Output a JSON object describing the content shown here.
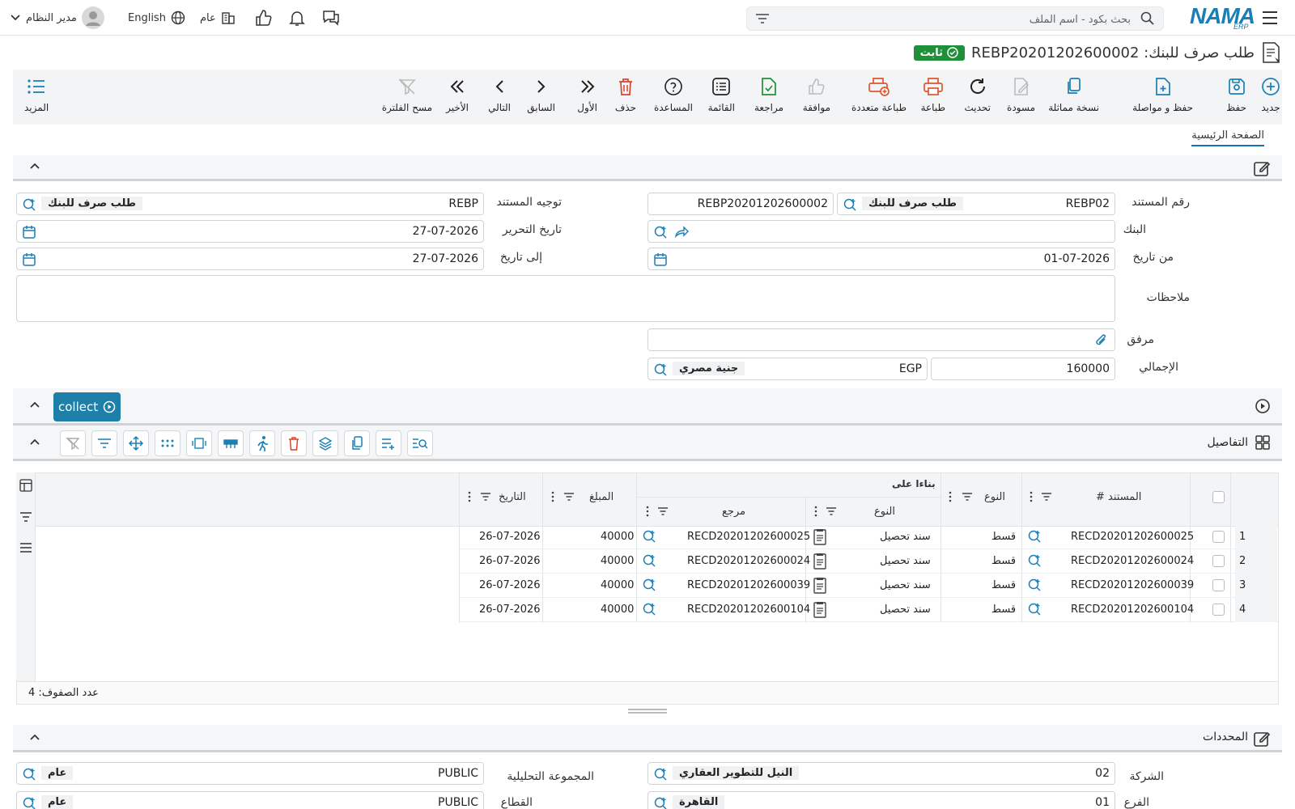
{
  "topbar": {
    "search_placeholder": "بحث بكود - اسم الملف",
    "user": "مدير النظام",
    "language": "English",
    "scope": "عام",
    "logo": "NAMA",
    "logo_sub": "ERP"
  },
  "title": {
    "text": "طلب صرف للبنك: REBP20201202600002",
    "status": "ثابت"
  },
  "toolbar": {
    "new": "جديد",
    "save": "حفظ",
    "save_continue": "حفظ و مواصلة",
    "duplicate": "نسخة مماثلة",
    "draft": "مسودة",
    "refresh": "تحديث",
    "print": "طباعة",
    "multi_print": "طباعة متعددة",
    "approve": "موافقة",
    "review": "مراجعة",
    "list": "القائمة",
    "help": "المساعدة",
    "delete": "حذف",
    "first": "الأول",
    "previous": "السابق",
    "next": "التالي",
    "last": "الأخير",
    "clear_filter": "مسح الفلترة",
    "more": "المزيد"
  },
  "tabs": {
    "main": "الصفحة الرئيسية"
  },
  "form": {
    "doc_number_label": "رقم المستند",
    "doc_book_code": "REBP02",
    "doc_book_name": "طلب صرف للبنك",
    "doc_code": "REBP20201202600002",
    "doc_direction_label": "توجيه المستند",
    "doc_direction_code": "REBP",
    "doc_direction_name": "طلب صرف للبنك",
    "bank_label": "البنك",
    "issue_date_label": "تاريخ التحرير",
    "issue_date": "27-07-2026",
    "from_date_label": "من تاريخ",
    "from_date": "01-07-2026",
    "to_date_label": "إلى تاريخ",
    "to_date": "27-07-2026",
    "notes_label": "ملاحظات",
    "attachment_label": "مرفق",
    "total_label": "الإجمالي",
    "total_value": "160000",
    "currency_code": "EGP",
    "currency_name": "جنية مصري"
  },
  "collect": {
    "label": "collect"
  },
  "details": {
    "title": "التفاصيل",
    "columns": {
      "doc": "# المستند",
      "type": "النوع",
      "based_on": "بناءا على",
      "based_type": "النوع",
      "ref": "مرجع",
      "amount": "المبلغ",
      "date": "التاريخ"
    },
    "rows": [
      {
        "n": "1",
        "doc": "RECD20201202600025",
        "type": "قسط",
        "based_type": "سند تحصيل",
        "ref": "RECD20201202600025",
        "amount": "40000",
        "date": "26-07-2026"
      },
      {
        "n": "2",
        "doc": "RECD20201202600024",
        "type": "قسط",
        "based_type": "سند تحصيل",
        "ref": "RECD20201202600024",
        "amount": "40000",
        "date": "26-07-2026"
      },
      {
        "n": "3",
        "doc": "RECD20201202600039",
        "type": "قسط",
        "based_type": "سند تحصيل",
        "ref": "RECD20201202600039",
        "amount": "40000",
        "date": "26-07-2026"
      },
      {
        "n": "4",
        "doc": "RECD20201202600104",
        "type": "قسط",
        "based_type": "سند تحصيل",
        "ref": "RECD20201202600104",
        "amount": "40000",
        "date": "26-07-2026"
      }
    ],
    "row_count": "عدد الصفوف: 4"
  },
  "dimensions": {
    "title": "المحددات",
    "company_label": "الشركة",
    "company_code": "02",
    "company_name": "النيل للتطوير العقاري",
    "analysis_label": "المجموعة التحليلية",
    "analysis_code": "PUBLIC",
    "analysis_name": "عام",
    "branch_label": "الفرع",
    "branch_code": "01",
    "branch_name": "القاهرة",
    "sector_label": "القطاع",
    "sector_code": "PUBLIC",
    "sector_name": "عام"
  },
  "colors": {
    "accent": "#1e7fa8",
    "status": "#1f8f3a",
    "danger": "#d9432b",
    "toolbar_blue": "#1a7fb5"
  }
}
